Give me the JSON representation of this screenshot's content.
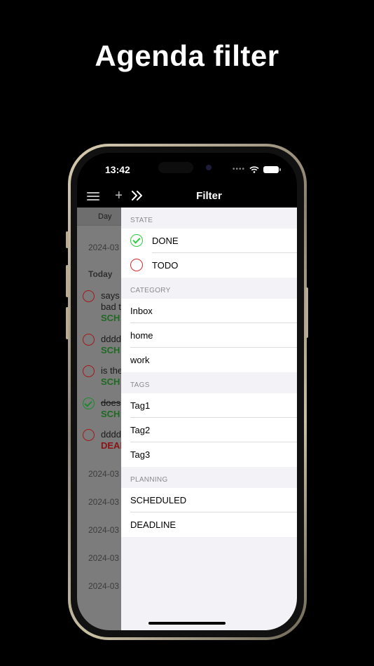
{
  "headline": "Agenda filter",
  "status": {
    "time": "13:42"
  },
  "nav": {
    "title": "Filter"
  },
  "agenda": {
    "tab": "Day",
    "today_label": "Today",
    "dates": [
      "2024-03",
      "2024-03",
      "2024-03",
      "2024-03",
      "2024-03",
      "2024-03"
    ],
    "items": [
      {
        "state": "todo",
        "lines": [
          "says",
          "bad t"
        ],
        "tag": "SCH",
        "tag_color": "green"
      },
      {
        "state": "todo",
        "lines": [
          "dddd"
        ],
        "tag": "SCH",
        "tag_color": "green"
      },
      {
        "state": "todo",
        "lines": [
          "is the"
        ],
        "tag": "SCH",
        "tag_color": "green"
      },
      {
        "state": "done",
        "lines": [
          "does"
        ],
        "tag": "SCH",
        "tag_color": "green"
      },
      {
        "state": "todo",
        "lines": [
          "dddd"
        ],
        "tag": "DEAI",
        "tag_color": "red"
      }
    ]
  },
  "filter": {
    "state": {
      "header": "STATE",
      "items": [
        {
          "label": "DONE",
          "icon": "done-check-icon"
        },
        {
          "label": "TODO",
          "icon": "todo-circle-icon"
        }
      ]
    },
    "category": {
      "header": "CATEGORY",
      "items": [
        "Inbox",
        "home",
        "work"
      ]
    },
    "tags": {
      "header": "TAGS",
      "items": [
        "Tag1",
        "Tag2",
        "Tag3"
      ]
    },
    "planning": {
      "header": "PLANNING",
      "items": [
        "SCHEDULED",
        "DEADLINE"
      ]
    }
  },
  "colors": {
    "done": "#2ecc40",
    "todo": "#d42a2a",
    "scheduled_tag": "#1e6a22",
    "deadline_tag": "#8a1212"
  }
}
